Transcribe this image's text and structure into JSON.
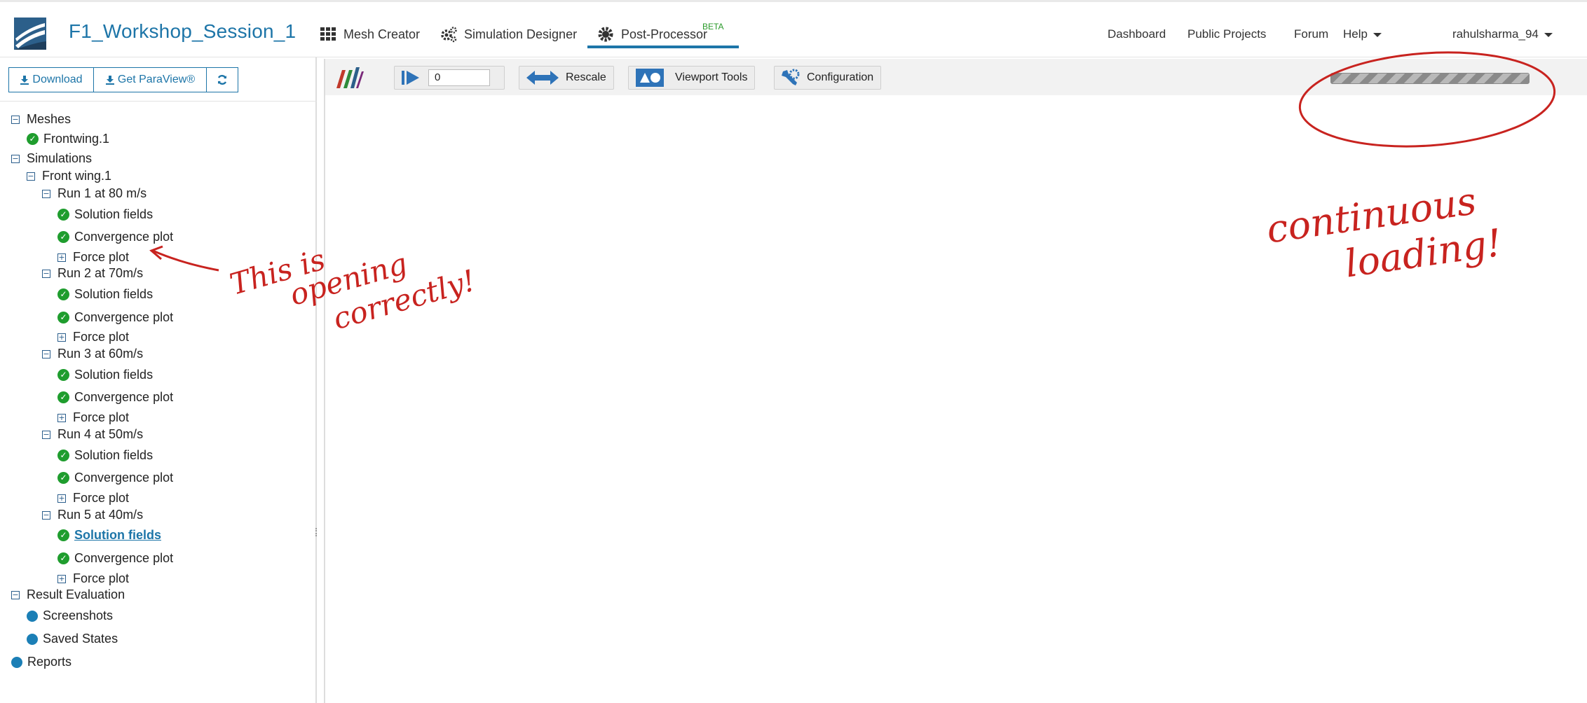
{
  "header": {
    "project_title": "F1_Workshop_Session_1",
    "nav": [
      {
        "label": "Mesh Creator",
        "icon": "grid-icon"
      },
      {
        "label": "Simulation Designer",
        "icon": "gears-icon"
      },
      {
        "label": "Post-Processor",
        "icon": "cog-icon",
        "badge": "BETA",
        "active": true
      }
    ],
    "right_links": [
      "Dashboard",
      "Public Projects",
      "Forum",
      "Help"
    ],
    "username": "rahulsharma_94"
  },
  "left_panel": {
    "buttons": {
      "download": "Download",
      "paraview": "Get ParaView®"
    },
    "tree": {
      "meshes": "Meshes",
      "mesh_item": "Frontwing.1",
      "simulations": "Simulations",
      "sim_item": "Front wing.1",
      "runs": [
        {
          "label": "Run 1 at 80 m/s"
        },
        {
          "label": "Run 2 at 70m/s"
        },
        {
          "label": "Run 3 at 60m/s"
        },
        {
          "label": "Run 4 at 50m/s"
        },
        {
          "label": "Run 5 at 40m/s"
        }
      ],
      "solution_fields": "Solution fields",
      "convergence_plot": "Convergence plot",
      "force_plot": "Force plot",
      "result_evaluation": "Result Evaluation",
      "screenshots": "Screenshots",
      "saved_states": "Saved States",
      "reports": "Reports"
    }
  },
  "viewer": {
    "frame_value": "0",
    "rescale": "Rescale",
    "viewport_tools": "Viewport Tools",
    "configuration": "Configuration"
  },
  "annotations": {
    "left": [
      "This is",
      "opening",
      "correctly!"
    ],
    "right": [
      "continuous",
      "loading!"
    ],
    "color": "#c8231f"
  },
  "colors": {
    "accent": "#1d75a8",
    "success": "#1f9d2e",
    "dot": "#1b7fb6"
  }
}
